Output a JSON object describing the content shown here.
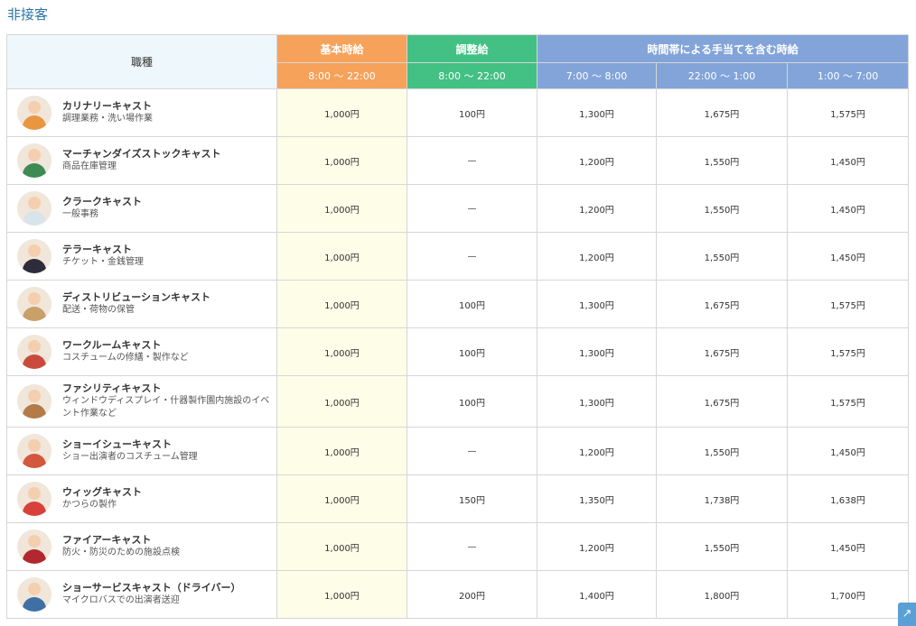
{
  "section_title": "非接客",
  "table": {
    "job_header": "職種",
    "groups": {
      "base": "基本時給",
      "adjust": "調整給",
      "time_band": "時間帯による手当てを含む時給"
    },
    "sub_headers": [
      "8:00 〜 22:00",
      "8:00 〜 22:00",
      "7:00 〜 8:00",
      "22:00 〜 1:00",
      "1:00 〜 7:00"
    ],
    "rows": [
      {
        "name": "カリナリーキャスト",
        "desc": "調理業務・洗い場作業",
        "values": [
          "1,000円",
          "100円",
          "1,300円",
          "1,675円",
          "1,575円"
        ],
        "avatar": "#e8963f"
      },
      {
        "name": "マーチャンダイズストックキャスト",
        "desc": "商品在庫管理",
        "values": [
          "1,000円",
          "—",
          "1,200円",
          "1,550円",
          "1,450円"
        ],
        "avatar": "#3d8a55"
      },
      {
        "name": "クラークキャスト",
        "desc": "一般事務",
        "values": [
          "1,000円",
          "—",
          "1,200円",
          "1,550円",
          "1,450円"
        ],
        "avatar": "#d9e4ea"
      },
      {
        "name": "テラーキャスト",
        "desc": "チケット・金銭管理",
        "values": [
          "1,000円",
          "—",
          "1,200円",
          "1,550円",
          "1,450円"
        ],
        "avatar": "#2c2c3a"
      },
      {
        "name": "ディストリビューションキャスト",
        "desc": "配送・荷物の保管",
        "values": [
          "1,000円",
          "100円",
          "1,300円",
          "1,675円",
          "1,575円"
        ],
        "avatar": "#c7a06a"
      },
      {
        "name": "ワークルームキャスト",
        "desc": "コスチュームの修繕・製作など",
        "values": [
          "1,000円",
          "100円",
          "1,300円",
          "1,675円",
          "1,575円"
        ],
        "avatar": "#c94a3c"
      },
      {
        "name": "ファシリティキャスト",
        "desc": "ウィンドウディスプレイ・什器製作園内施設のイベント作業など",
        "values": [
          "1,000円",
          "100円",
          "1,300円",
          "1,675円",
          "1,575円"
        ],
        "avatar": "#b47a48"
      },
      {
        "name": "ショーイシューキャスト",
        "desc": "ショー出演者のコスチューム管理",
        "values": [
          "1,000円",
          "—",
          "1,200円",
          "1,550円",
          "1,450円"
        ],
        "avatar": "#d2573c"
      },
      {
        "name": "ウィッグキャスト",
        "desc": "かつらの製作",
        "values": [
          "1,000円",
          "150円",
          "1,350円",
          "1,738円",
          "1,638円"
        ],
        "avatar": "#d8413a"
      },
      {
        "name": "ファイアーキャスト",
        "desc": "防火・防災のための施設点検",
        "values": [
          "1,000円",
          "—",
          "1,200円",
          "1,550円",
          "1,450円"
        ],
        "avatar": "#b3282f"
      },
      {
        "name": "ショーサービスキャスト（ドライバー）",
        "desc": "マイクロバスでの出演者送迎",
        "values": [
          "1,000円",
          "200円",
          "1,400円",
          "1,800円",
          "1,700円"
        ],
        "avatar": "#3f6fa3"
      }
    ]
  },
  "scroll_top_icon": "arrow-up-right-icon",
  "scroll_top_glyph": "↗"
}
